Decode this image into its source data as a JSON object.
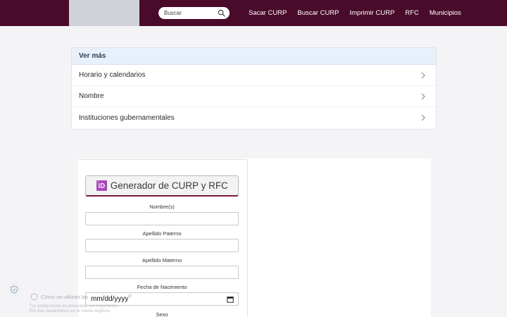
{
  "header": {
    "search_placeholder": "Buscar",
    "nav": [
      "Sacar CURP",
      "Buscar CURP",
      "Imprimir CURP",
      "RFC",
      "Municipios"
    ]
  },
  "ver_mas": {
    "title": "Ver más",
    "items": [
      "Horario y calendarios",
      "Nombre",
      "Instituciones gubernamentales"
    ]
  },
  "form": {
    "button_label": "🆔 Generador de CURP y RFC",
    "fields": {
      "nombre": "Nombre(s)",
      "paterno": "Apellido Paterno",
      "materno": "Apellido Materno",
      "fecha": "Fecha de Nacimiento",
      "sexo": "Sexo"
    },
    "date_placeholder": "mm/dd/yyyy"
  },
  "cookie": {
    "title": "Cómo se utilizan las",
    "line1": "Tus preferencias de privacidad son importantes.",
    "line2": "Por eso, basándonos en el interés legítimo,"
  },
  "colors": {
    "header_bg": "#4a0b2b",
    "accent": "#7a1a36"
  }
}
